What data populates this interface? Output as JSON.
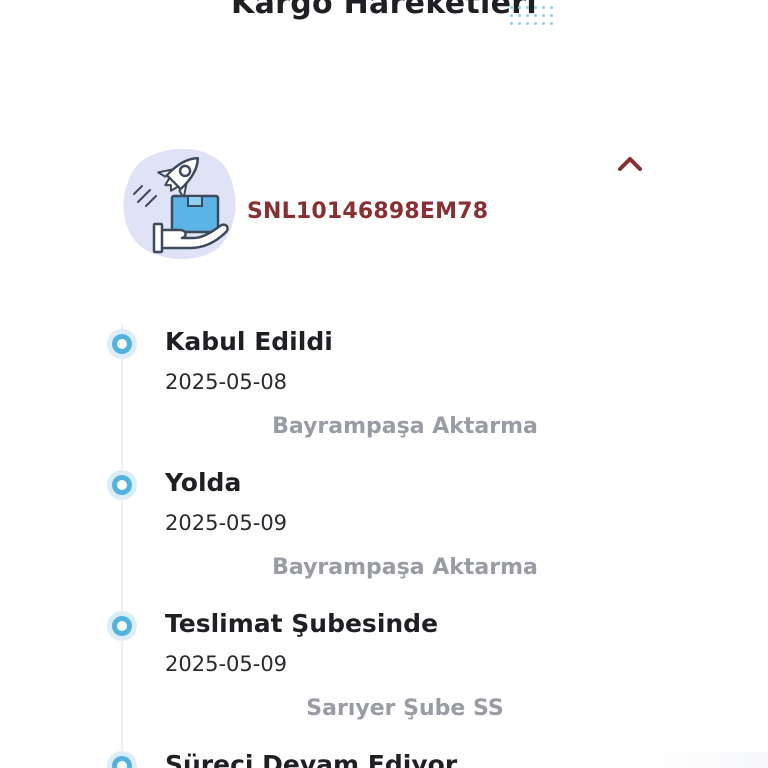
{
  "page": {
    "title": "Kargo Hareketleri"
  },
  "shipment": {
    "tracking_number": "SNL10146898EM78",
    "illustration_icon": "rocket-package-hand-icon",
    "toggle_icon": "chevron-up-icon"
  },
  "timeline": [
    {
      "status": "Kabul Edildi",
      "date": "2025-05-08",
      "location": "Bayrampaşa Aktarma"
    },
    {
      "status": "Yolda",
      "date": "2025-05-09",
      "location": "Bayrampaşa Aktarma"
    },
    {
      "status": "Teslimat Şubesinde",
      "date": "2025-05-09",
      "location": "Sarıyer Şube SS"
    },
    {
      "status": "Süreci Devam Ediyor",
      "date": "",
      "location": ""
    }
  ],
  "colors": {
    "title": "#1f1f24",
    "tracking_number": "#8b2e31",
    "timeline_dot": "#53b3df",
    "location_text": "#9a9ca3"
  }
}
